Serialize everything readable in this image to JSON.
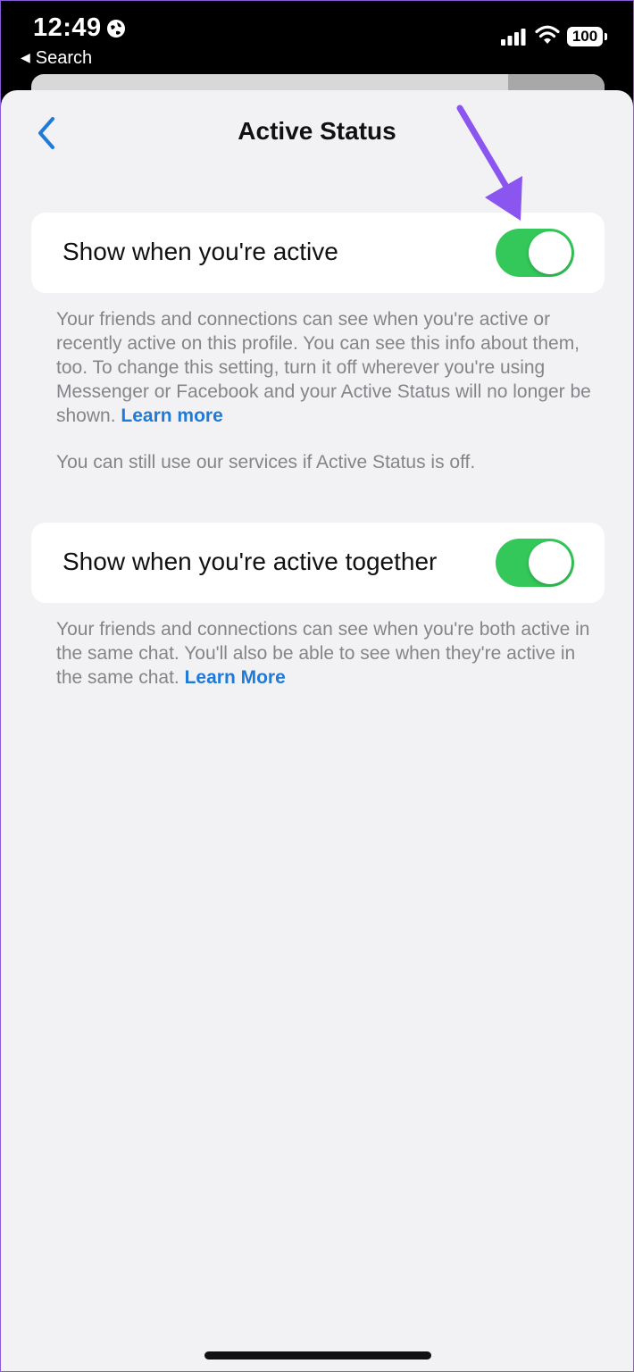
{
  "status_bar": {
    "time": "12:49",
    "back_app": "Search",
    "battery": "100",
    "icons": [
      "globe-icon",
      "cellular-signal-icon",
      "wifi-icon",
      "battery-icon"
    ]
  },
  "header": {
    "title": "Active Status",
    "back_icon": "chevron-left-icon"
  },
  "settings": [
    {
      "label": "Show when you're active",
      "enabled": true,
      "description": "Your friends and connections can see when you're active or recently active on this profile. You can see this info about them, too. To change this setting, turn it off wherever you're using Messenger or Facebook and your Active Status will no longer be shown.",
      "link": "Learn more",
      "note": "You can still use our services if Active Status is off."
    },
    {
      "label": "Show when you're active together",
      "enabled": true,
      "description": "Your friends and connections can see when you're both active in the same chat. You'll also be able to see when they're active in the same chat.",
      "link": "Learn More"
    }
  ],
  "colors": {
    "toggle_on": "#34c759",
    "link": "#1f7ad8",
    "annotation_arrow": "#8b55f0",
    "background": "#f2f2f4"
  }
}
